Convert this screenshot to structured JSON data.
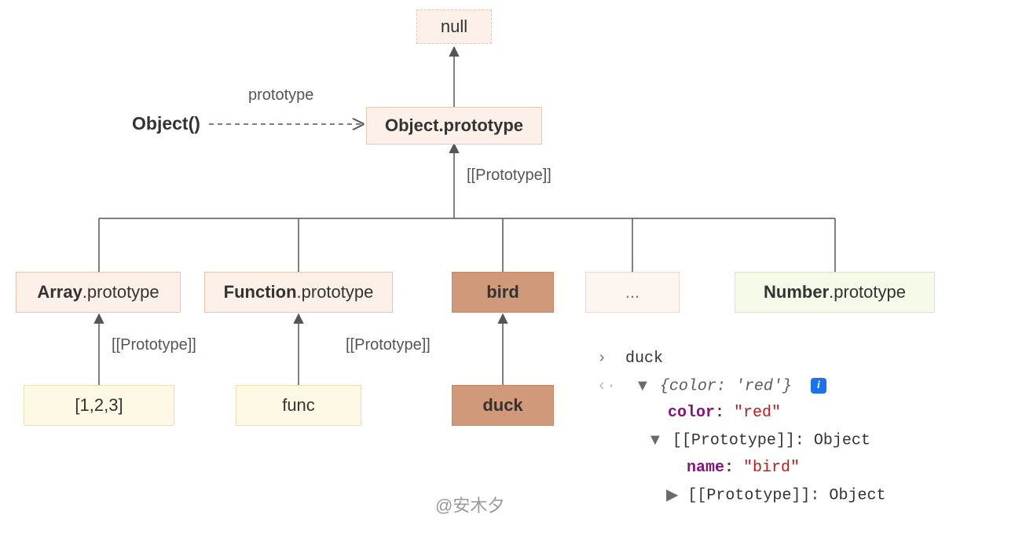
{
  "nodes": {
    "null": "null",
    "objectFn": "Object()",
    "objectProto": "Object.prototype",
    "arrayProto_b": "Array",
    "arrayProto_s": ".prototype",
    "funcProto_b": "Function",
    "funcProto_s": ".prototype",
    "bird": "bird",
    "ellipsis": "...",
    "numberProto_b": "Number",
    "numberProto_s": ".prototype",
    "arr123": "[1,2,3]",
    "func": "func",
    "duck": "duck"
  },
  "labels": {
    "prototype": "prototype",
    "protoSlot": "[[Prototype]]",
    "protoSlot2": "[[Prototype]]",
    "protoSlot3": "[[Prototype]]"
  },
  "console": {
    "prompt": "›",
    "input": "duck",
    "outPrompt": "‹·",
    "summary_open": "{",
    "summary_kv": "color: 'red'",
    "summary_close": "}",
    "line_color_k": "color:",
    "line_color_v": "\"red\"",
    "line_proto1": "[[Prototype]]: Object",
    "line_name_k": "name:",
    "line_name_v": "\"bird\"",
    "line_proto2": "[[Prototype]]: Object"
  },
  "watermark": "@安木夕"
}
